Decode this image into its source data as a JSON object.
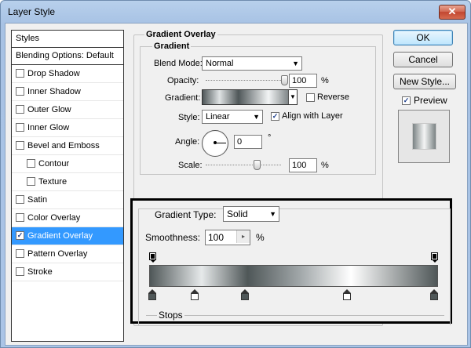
{
  "window": {
    "title": "Layer Style",
    "close_glyph": "✕"
  },
  "styles": {
    "header": "Styles",
    "blending": "Blending Options: Default",
    "items": [
      {
        "label": "Drop Shadow",
        "checked": false
      },
      {
        "label": "Inner Shadow",
        "checked": false
      },
      {
        "label": "Outer Glow",
        "checked": false
      },
      {
        "label": "Inner Glow",
        "checked": false
      },
      {
        "label": "Bevel and Emboss",
        "checked": false
      },
      {
        "label": "Contour",
        "checked": false,
        "sub": true
      },
      {
        "label": "Texture",
        "checked": false,
        "sub": true
      },
      {
        "label": "Satin",
        "checked": false
      },
      {
        "label": "Color Overlay",
        "checked": false
      },
      {
        "label": "Gradient Overlay",
        "checked": true,
        "selected": true
      },
      {
        "label": "Pattern Overlay",
        "checked": false
      },
      {
        "label": "Stroke",
        "checked": false
      }
    ]
  },
  "overlay": {
    "title": "Gradient Overlay",
    "subtitle": "Gradient",
    "blend_mode_label": "Blend Mode:",
    "blend_mode": "Normal",
    "opacity_label": "Opacity:",
    "opacity": "100",
    "opacity_level": 1.0,
    "percent": "%",
    "gradient_label": "Gradient:",
    "reverse_label": "Reverse",
    "reverse_checked": false,
    "style_label": "Style:",
    "style": "Linear",
    "align_label": "Align with Layer",
    "align_checked": true,
    "angle_label": "Angle:",
    "angle": "0",
    "degree": "°",
    "scale_label": "Scale:",
    "scale": "100",
    "scale_level": 0.66
  },
  "buttons": {
    "ok": "OK",
    "cancel": "Cancel",
    "new_style": "New Style...",
    "preview": "Preview",
    "preview_checked": true
  },
  "editor": {
    "type_label": "Gradient Type:",
    "type": "Solid",
    "smoothness_label": "Smoothness:",
    "smoothness": "100",
    "percent": "%",
    "stops_label": "Stops",
    "opacity_stops": [
      0,
      1
    ],
    "color_stops": [
      0,
      0.15,
      0.33,
      0.69,
      1
    ]
  },
  "colors": {
    "accent": "#3399ff",
    "stop_dark": "#4f5758",
    "stop_light": "#ffffff"
  }
}
